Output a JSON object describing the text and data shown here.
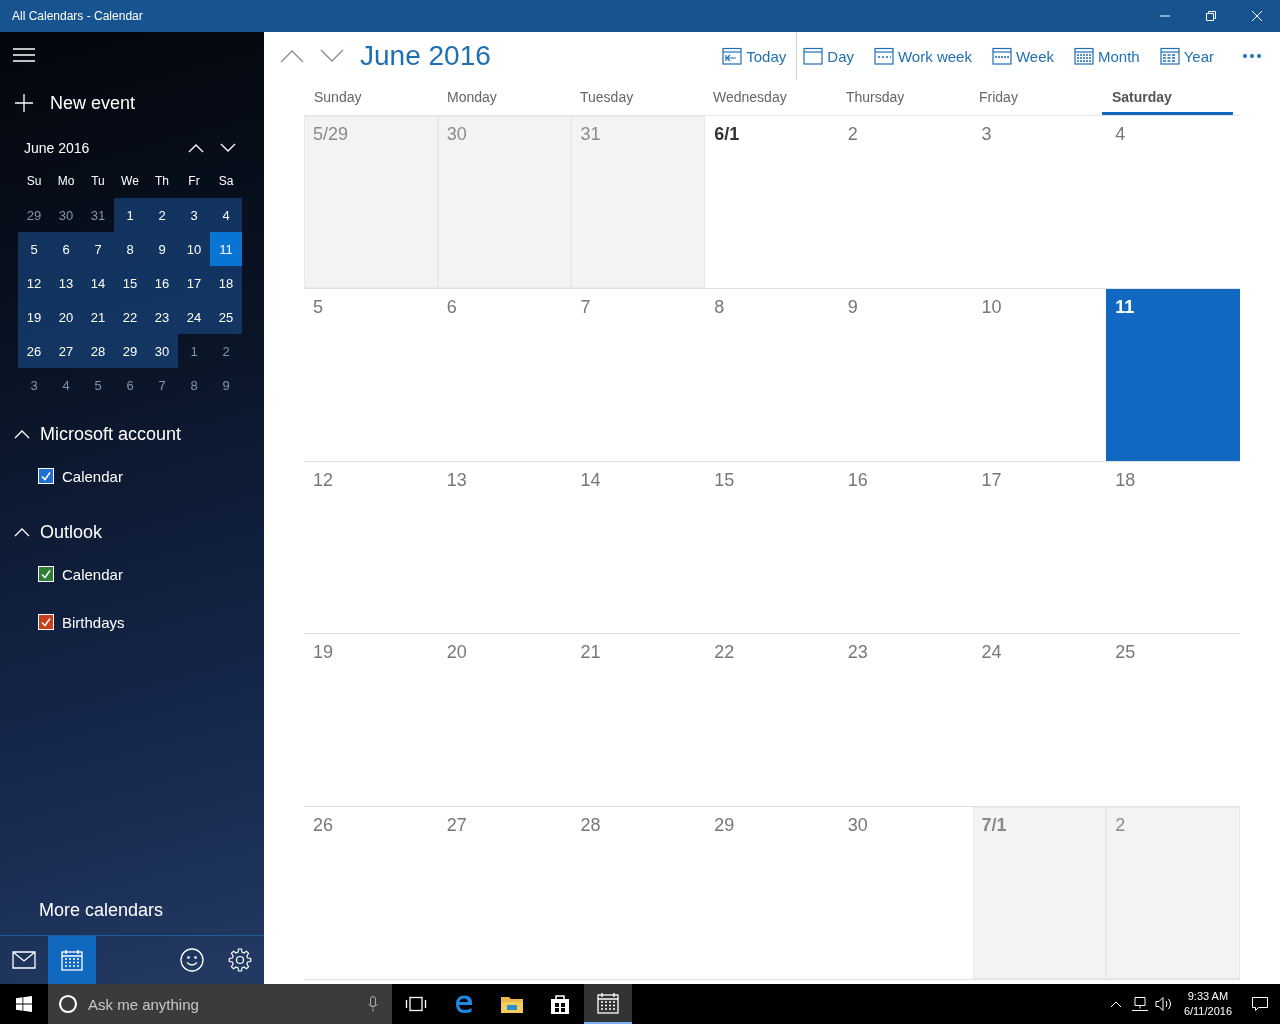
{
  "window": {
    "title": "All Calendars - Calendar"
  },
  "sidebar": {
    "new_event": "New event",
    "mini_calendar": {
      "title": "June 2016",
      "weekdays": [
        "Su",
        "Mo",
        "Tu",
        "We",
        "Th",
        "Fr",
        "Sa"
      ],
      "days": [
        {
          "label": "29",
          "in_month": false,
          "selected": false
        },
        {
          "label": "30",
          "in_month": false,
          "selected": false
        },
        {
          "label": "31",
          "in_month": false,
          "selected": false
        },
        {
          "label": "1",
          "in_month": true,
          "selected": false
        },
        {
          "label": "2",
          "in_month": true,
          "selected": false
        },
        {
          "label": "3",
          "in_month": true,
          "selected": false
        },
        {
          "label": "4",
          "in_month": true,
          "selected": false
        },
        {
          "label": "5",
          "in_month": true,
          "selected": false
        },
        {
          "label": "6",
          "in_month": true,
          "selected": false
        },
        {
          "label": "7",
          "in_month": true,
          "selected": false
        },
        {
          "label": "8",
          "in_month": true,
          "selected": false
        },
        {
          "label": "9",
          "in_month": true,
          "selected": false
        },
        {
          "label": "10",
          "in_month": true,
          "selected": false
        },
        {
          "label": "11",
          "in_month": true,
          "selected": true
        },
        {
          "label": "12",
          "in_month": true,
          "selected": false
        },
        {
          "label": "13",
          "in_month": true,
          "selected": false
        },
        {
          "label": "14",
          "in_month": true,
          "selected": false
        },
        {
          "label": "15",
          "in_month": true,
          "selected": false
        },
        {
          "label": "16",
          "in_month": true,
          "selected": false
        },
        {
          "label": "17",
          "in_month": true,
          "selected": false
        },
        {
          "label": "18",
          "in_month": true,
          "selected": false
        },
        {
          "label": "19",
          "in_month": true,
          "selected": false
        },
        {
          "label": "20",
          "in_month": true,
          "selected": false
        },
        {
          "label": "21",
          "in_month": true,
          "selected": false
        },
        {
          "label": "22",
          "in_month": true,
          "selected": false
        },
        {
          "label": "23",
          "in_month": true,
          "selected": false
        },
        {
          "label": "24",
          "in_month": true,
          "selected": false
        },
        {
          "label": "25",
          "in_month": true,
          "selected": false
        },
        {
          "label": "26",
          "in_month": true,
          "selected": false
        },
        {
          "label": "27",
          "in_month": true,
          "selected": false
        },
        {
          "label": "28",
          "in_month": true,
          "selected": false
        },
        {
          "label": "29",
          "in_month": true,
          "selected": false
        },
        {
          "label": "30",
          "in_month": true,
          "selected": false
        },
        {
          "label": "1",
          "in_month": false,
          "selected": false
        },
        {
          "label": "2",
          "in_month": false,
          "selected": false
        },
        {
          "label": "3",
          "in_month": false,
          "selected": false
        },
        {
          "label": "4",
          "in_month": false,
          "selected": false
        },
        {
          "label": "5",
          "in_month": false,
          "selected": false
        },
        {
          "label": "6",
          "in_month": false,
          "selected": false
        },
        {
          "label": "7",
          "in_month": false,
          "selected": false
        },
        {
          "label": "8",
          "in_month": false,
          "selected": false
        },
        {
          "label": "9",
          "in_month": false,
          "selected": false
        }
      ]
    },
    "accounts": [
      {
        "name": "Microsoft account",
        "expanded": true,
        "calendars": [
          {
            "name": "Calendar",
            "checked": true,
            "color": "#1e6fd0"
          }
        ]
      },
      {
        "name": "Outlook",
        "expanded": true,
        "calendars": [
          {
            "name": "Calendar",
            "checked": true,
            "color": "#2f7d32"
          },
          {
            "name": "Birthdays",
            "checked": true,
            "color": "#c8401a"
          }
        ]
      }
    ],
    "more_calendars": "More calendars",
    "nav": [
      {
        "kind": "mail",
        "selected": false
      },
      {
        "kind": "calendar",
        "selected": true
      },
      {
        "kind": "feedback",
        "selected": false
      },
      {
        "kind": "settings",
        "selected": false
      }
    ]
  },
  "main": {
    "title": "June 2016",
    "views": [
      {
        "label": "Today",
        "kind": "today"
      },
      {
        "label": "Day",
        "kind": "day"
      },
      {
        "label": "Work week",
        "kind": "workweek"
      },
      {
        "label": "Week",
        "kind": "week"
      },
      {
        "label": "Month",
        "kind": "month"
      },
      {
        "label": "Year",
        "kind": "year"
      }
    ],
    "weekdays": [
      {
        "label": "Sunday",
        "selected": false
      },
      {
        "label": "Monday",
        "selected": false
      },
      {
        "label": "Tuesday",
        "selected": false
      },
      {
        "label": "Wednesday",
        "selected": false
      },
      {
        "label": "Thursday",
        "selected": false
      },
      {
        "label": "Friday",
        "selected": false
      },
      {
        "label": "Saturday",
        "selected": true
      }
    ],
    "weeks": [
      [
        {
          "label": "5/29",
          "outside": true,
          "today": false,
          "month_start": false
        },
        {
          "label": "30",
          "outside": true,
          "today": false,
          "month_start": false
        },
        {
          "label": "31",
          "outside": true,
          "today": false,
          "month_start": false
        },
        {
          "label": "6/1",
          "outside": false,
          "today": false,
          "month_start": true
        },
        {
          "label": "2",
          "outside": false,
          "today": false,
          "month_start": false
        },
        {
          "label": "3",
          "outside": false,
          "today": false,
          "month_start": false
        },
        {
          "label": "4",
          "outside": false,
          "today": false,
          "month_start": false
        }
      ],
      [
        {
          "label": "5",
          "outside": false,
          "today": false,
          "month_start": false
        },
        {
          "label": "6",
          "outside": false,
          "today": false,
          "month_start": false
        },
        {
          "label": "7",
          "outside": false,
          "today": false,
          "month_start": false
        },
        {
          "label": "8",
          "outside": false,
          "today": false,
          "month_start": false
        },
        {
          "label": "9",
          "outside": false,
          "today": false,
          "month_start": false
        },
        {
          "label": "10",
          "outside": false,
          "today": false,
          "month_start": false
        },
        {
          "label": "11",
          "outside": false,
          "today": true,
          "month_start": false
        }
      ],
      [
        {
          "label": "12",
          "outside": false,
          "today": false,
          "month_start": false
        },
        {
          "label": "13",
          "outside": false,
          "today": false,
          "month_start": false
        },
        {
          "label": "14",
          "outside": false,
          "today": false,
          "month_start": false
        },
        {
          "label": "15",
          "outside": false,
          "today": false,
          "month_start": false
        },
        {
          "label": "16",
          "outside": false,
          "today": false,
          "month_start": false
        },
        {
          "label": "17",
          "outside": false,
          "today": false,
          "month_start": false
        },
        {
          "label": "18",
          "outside": false,
          "today": false,
          "month_start": false
        }
      ],
      [
        {
          "label": "19",
          "outside": false,
          "today": false,
          "month_start": false
        },
        {
          "label": "20",
          "outside": false,
          "today": false,
          "month_start": false
        },
        {
          "label": "21",
          "outside": false,
          "today": false,
          "month_start": false
        },
        {
          "label": "22",
          "outside": false,
          "today": false,
          "month_start": false
        },
        {
          "label": "23",
          "outside": false,
          "today": false,
          "month_start": false
        },
        {
          "label": "24",
          "outside": false,
          "today": false,
          "month_start": false
        },
        {
          "label": "25",
          "outside": false,
          "today": false,
          "month_start": false
        }
      ],
      [
        {
          "label": "26",
          "outside": false,
          "today": false,
          "month_start": false
        },
        {
          "label": "27",
          "outside": false,
          "today": false,
          "month_start": false
        },
        {
          "label": "28",
          "outside": false,
          "today": false,
          "month_start": false
        },
        {
          "label": "29",
          "outside": false,
          "today": false,
          "month_start": false
        },
        {
          "label": "30",
          "outside": false,
          "today": false,
          "month_start": false
        },
        {
          "label": "7/1",
          "outside": true,
          "today": false,
          "month_start": true
        },
        {
          "label": "2",
          "outside": true,
          "today": false,
          "month_start": false
        }
      ]
    ]
  },
  "taskbar": {
    "search": {
      "placeholder": "Ask me anything"
    },
    "apps": [
      {
        "kind": "taskview",
        "selected": false
      },
      {
        "kind": "edge",
        "selected": false
      },
      {
        "kind": "explorer",
        "selected": false
      },
      {
        "kind": "store",
        "selected": false
      },
      {
        "kind": "calendar",
        "selected": true
      }
    ],
    "time": "9:33 AM",
    "date": "6/11/2016"
  }
}
